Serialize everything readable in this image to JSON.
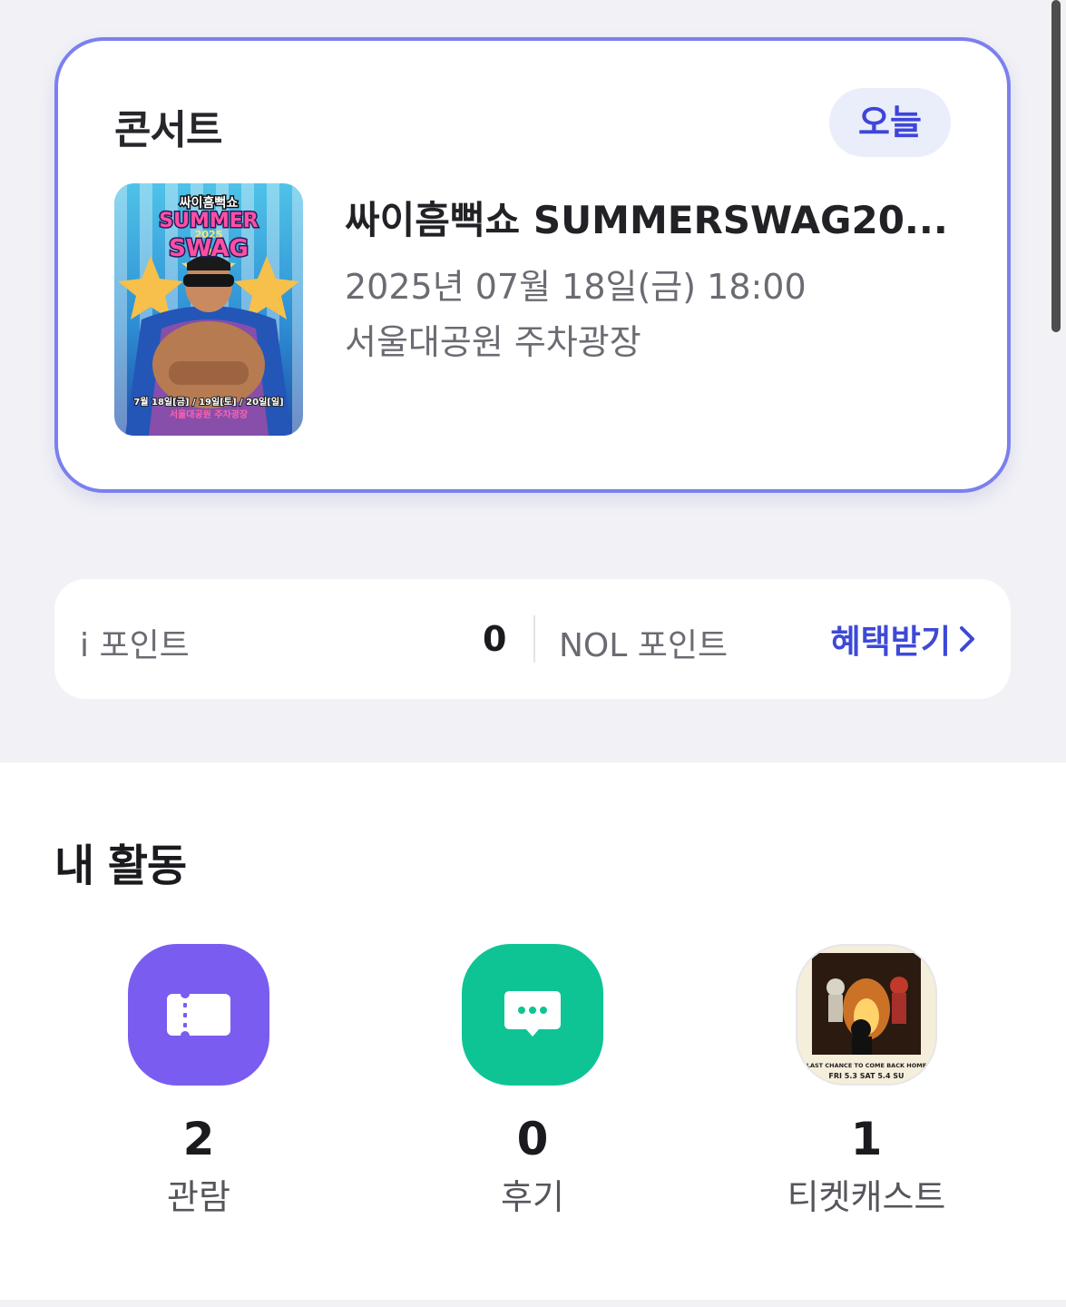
{
  "concert_card": {
    "category": "콘서트",
    "badge": "오늘",
    "title": "싸이흠뻑쇼 SUMMERSWAG20...",
    "datetime": "2025년 07월 18일(금) 18:00",
    "venue": "서울대공원 주차광장",
    "poster": {
      "show_name": "싸이흠뻑쇼",
      "headline_top": "SUMMER",
      "headline_year": "2025",
      "headline_bottom": "SWAG",
      "dates": "7월 18일[금] / 19일[토] / 20일[일]",
      "place": "서울대공원 주차광장"
    }
  },
  "points": {
    "ipoint_label": "i 포인트",
    "ipoint_value": "0",
    "nol_label": "NOL 포인트",
    "benefit_link": "혜택받기"
  },
  "activity": {
    "title": "내 활동",
    "items": [
      {
        "count": "2",
        "label": "관람",
        "icon": "ticket-icon",
        "color": "#7b5cf0"
      },
      {
        "count": "0",
        "label": "후기",
        "icon": "chat-bubble-icon",
        "color": "#0fc494"
      },
      {
        "count": "1",
        "label": "티켓캐스트",
        "icon": "ticketcast-thumbnail",
        "thumb_caption": "\"LAST CHANCE TO COME BACK HOME\"",
        "thumb_dates": "FRI  5.3 SAT  5.4 SU"
      }
    ]
  },
  "colors": {
    "accent": "#3d49d6",
    "card_border": "#7b80ee",
    "badge_bg": "#eaeefb",
    "background": "#f1f1f6"
  }
}
